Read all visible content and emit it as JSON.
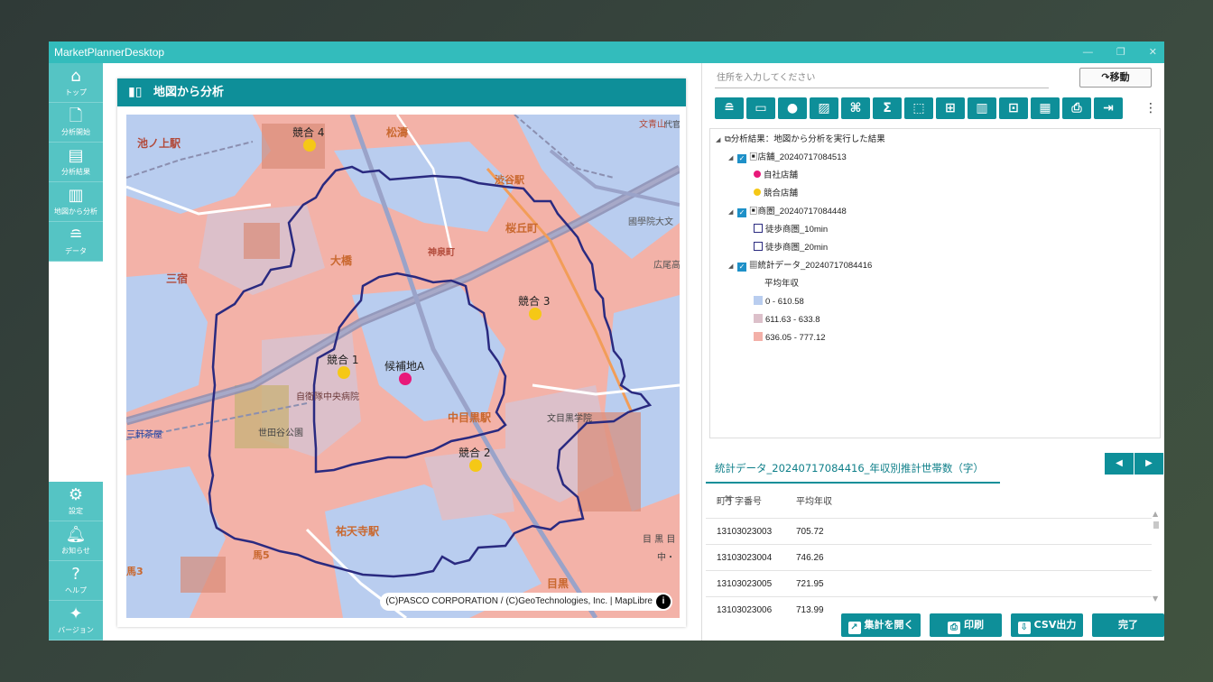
{
  "app": {
    "title": "MarketPlannerDesktop"
  },
  "nav": {
    "top": [
      {
        "label": "トップ",
        "icon": "home-icon"
      },
      {
        "label": "分析開始",
        "icon": "new-document-icon"
      },
      {
        "label": "分析結果",
        "icon": "report-icon"
      },
      {
        "label": "地図から分析",
        "icon": "map-icon"
      },
      {
        "label": "データ",
        "icon": "database-icon"
      }
    ],
    "bottom": [
      {
        "label": "設定",
        "icon": "gear-icon"
      },
      {
        "label": "お知らせ",
        "icon": "bell-icon"
      },
      {
        "label": "ヘルプ",
        "icon": "help-icon"
      },
      {
        "label": "バージョン",
        "icon": "sparkle-icon"
      }
    ]
  },
  "panel": {
    "title": "地図から分析"
  },
  "map": {
    "attribution": "(C)PASCO CORPORATION / (C)GeoTechnologies, Inc. | MapLibre",
    "markers": [
      {
        "label": "競合 4",
        "type": "competitor"
      },
      {
        "label": "競合 3",
        "type": "competitor"
      },
      {
        "label": "競合 1",
        "type": "competitor"
      },
      {
        "label": "競合 2",
        "type": "competitor"
      },
      {
        "label": "候補地A",
        "type": "own"
      }
    ],
    "place_labels": [
      "池ノ上駅",
      "松濤",
      "文青山",
      "渋谷駅",
      "桜丘町",
      "神泉町",
      "大橋",
      "三宿",
      "國學院大文",
      "広尾高",
      "自衛隊中央病院",
      "中目黒駅",
      "世田谷公園",
      "三軒茶屋",
      "祐天寺駅",
      "目黒",
      "文目黒学院",
      "馬5",
      "馬3",
      "目 黒 目",
      "中・",
      "代官"
    ],
    "colors": {
      "own": "#e8197a",
      "competitor": "#f2c80f",
      "area_outline": "#2a2a80",
      "band_low": "#b8cdf0",
      "band_mid": "#dcbfc9",
      "band_high": "#f3b0a8"
    }
  },
  "right": {
    "address_placeholder": "住所を入力してください",
    "move_button": "移動",
    "toolbar_icons": [
      "database-icon",
      "store-icon",
      "person-icon",
      "hatch-icon",
      "network-icon",
      "sigma-icon",
      "select-icon",
      "frame-icon",
      "bar-chart-icon",
      "bag-icon",
      "table-icon",
      "printer-icon",
      "export-icon"
    ],
    "tree": {
      "root": "分析結果：地図から分析を実行した結果",
      "store_layer": "店舗_20240717084513",
      "own_store": "自社店舗",
      "competitor_store": "競合店舗",
      "trade_layer": "商圏_20240717084448",
      "walk10": "徒歩商圏_10min",
      "walk20": "徒歩商圏_20min",
      "stats_layer": "統計データ_20240717084416",
      "metric": "平均年収",
      "bands": [
        "0 - 610.58",
        "611.63 - 633.8",
        "636.05 - 777.12"
      ]
    },
    "tab": {
      "title": "統計データ_20240717084416_年収別推計世帯数（字）"
    },
    "table": {
      "headers": [
        "町丁字番号",
        "平均年収"
      ],
      "rows": [
        [
          "13103023003",
          "705.72"
        ],
        [
          "13103023004",
          "746.26"
        ],
        [
          "13103023005",
          "721.95"
        ],
        [
          "13103023006",
          "713.99"
        ]
      ]
    },
    "actions": {
      "open": "集計を開く",
      "print": "印刷",
      "csv": "CSV出力",
      "done": "完了"
    }
  }
}
